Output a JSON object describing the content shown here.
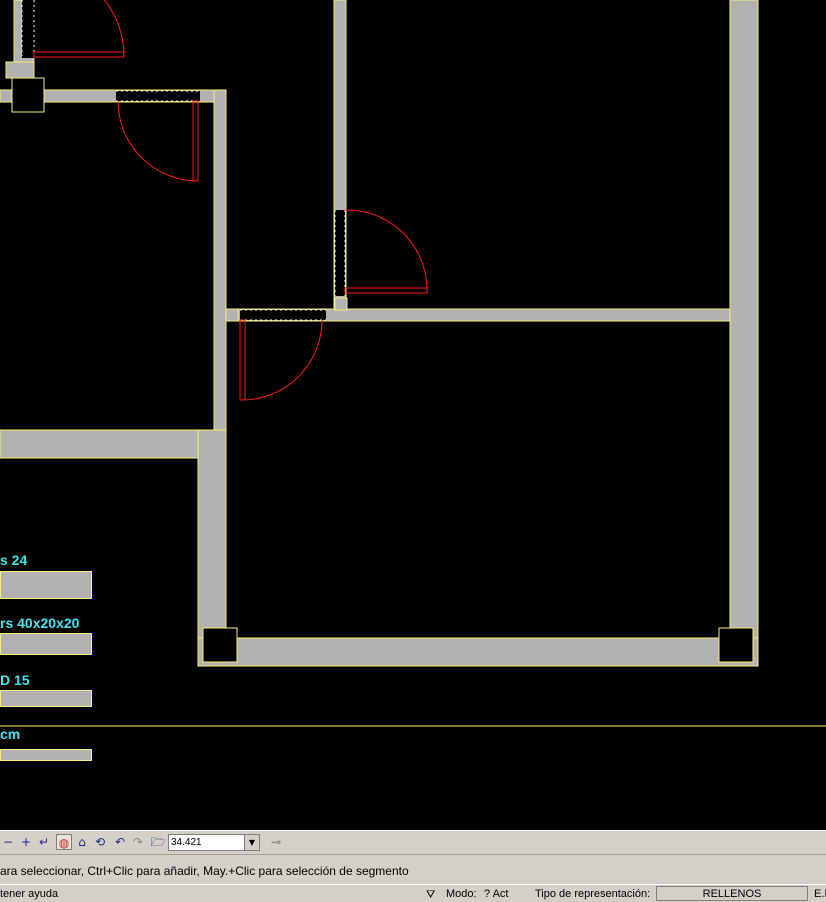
{
  "legend": {
    "items": [
      {
        "label": "s 24"
      },
      {
        "label": "rs 40x20x20"
      },
      {
        "label": "D 15"
      },
      {
        "label": "cm"
      }
    ]
  },
  "toolbar": {
    "zoom_value": "34.421",
    "icons": [
      "minus-icon",
      "plus-icon",
      "arrow-left-icon",
      "fill-icon",
      "polygon-icon",
      "rotate-icon",
      "undo-icon",
      "redo-icon",
      "folder-icon",
      "pin-icon"
    ]
  },
  "prompt": {
    "text": "ara seleccionar, Ctrl+Clic para añadir, May.+Clic para selección de segmento"
  },
  "status": {
    "help": "tener ayuda",
    "mode_label": "Modo:",
    "mode_value": "? Act",
    "rep_label": "Tipo de representación:",
    "rep_value": "RELLENOS",
    "trailing": "E.I"
  },
  "colors": {
    "wall_fill": "#b2b2b2",
    "wall_edge": "#f4ef7a",
    "door": "#ff1a1a",
    "text_cyan": "#3fe7f2",
    "background": "#000000"
  }
}
